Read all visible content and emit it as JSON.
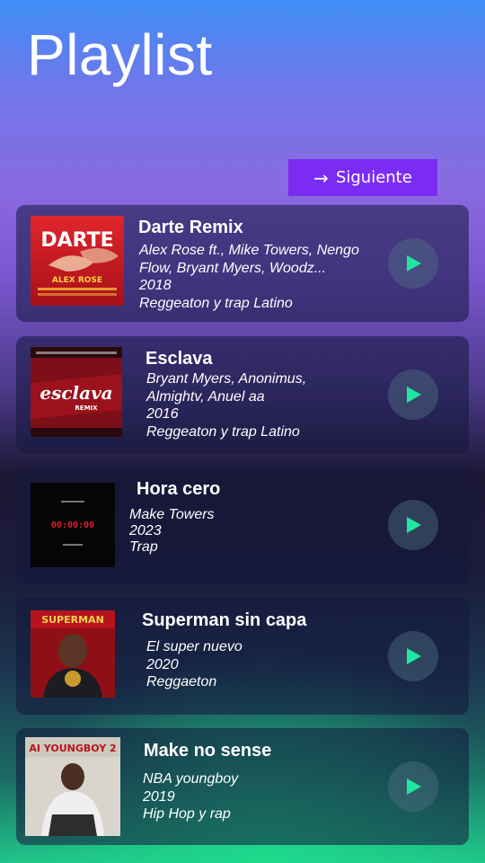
{
  "header": {
    "title": "Playlist"
  },
  "next_button": {
    "label": "Siguiente",
    "icon": "arrow-right-icon"
  },
  "colors": {
    "accent_button": "#7b2cf3",
    "play_icon": "#1ee8a0"
  },
  "songs": [
    {
      "title": "Darte Remix",
      "artist_line1": "Alex Rose ft., Mike Towers, Nengo",
      "artist_line2": "Flow, Bryant Myers, Woodz...",
      "year": "2018",
      "genre": "Reggeaton y trap Latino",
      "cover_text": "DARTE",
      "cover_sub": "ALEX ROSE"
    },
    {
      "title": "Esclava",
      "artist_line1": "Bryant Myers, Anonimus,",
      "artist_line2": "Almightv, Anuel aa",
      "year": "2016",
      "genre": "Reggeaton y trap Latino",
      "cover_text": "esclava",
      "cover_sub": "REMIX"
    },
    {
      "title": "Hora cero",
      "artist_line1": "Make Towers",
      "year": "2023",
      "genre": "Trap",
      "cover_text": "00:00:00"
    },
    {
      "title": "Superman sin capa",
      "artist_line1": "El super nuevo",
      "year": "2020",
      "genre": "Reggaeton",
      "cover_text": "SUPERMAN"
    },
    {
      "title": "Make no sense",
      "artist_line1": "NBA youngboy",
      "year": "2019",
      "genre": "Hip Hop y rap",
      "cover_text": "AI YOUNGBOY 2"
    }
  ]
}
